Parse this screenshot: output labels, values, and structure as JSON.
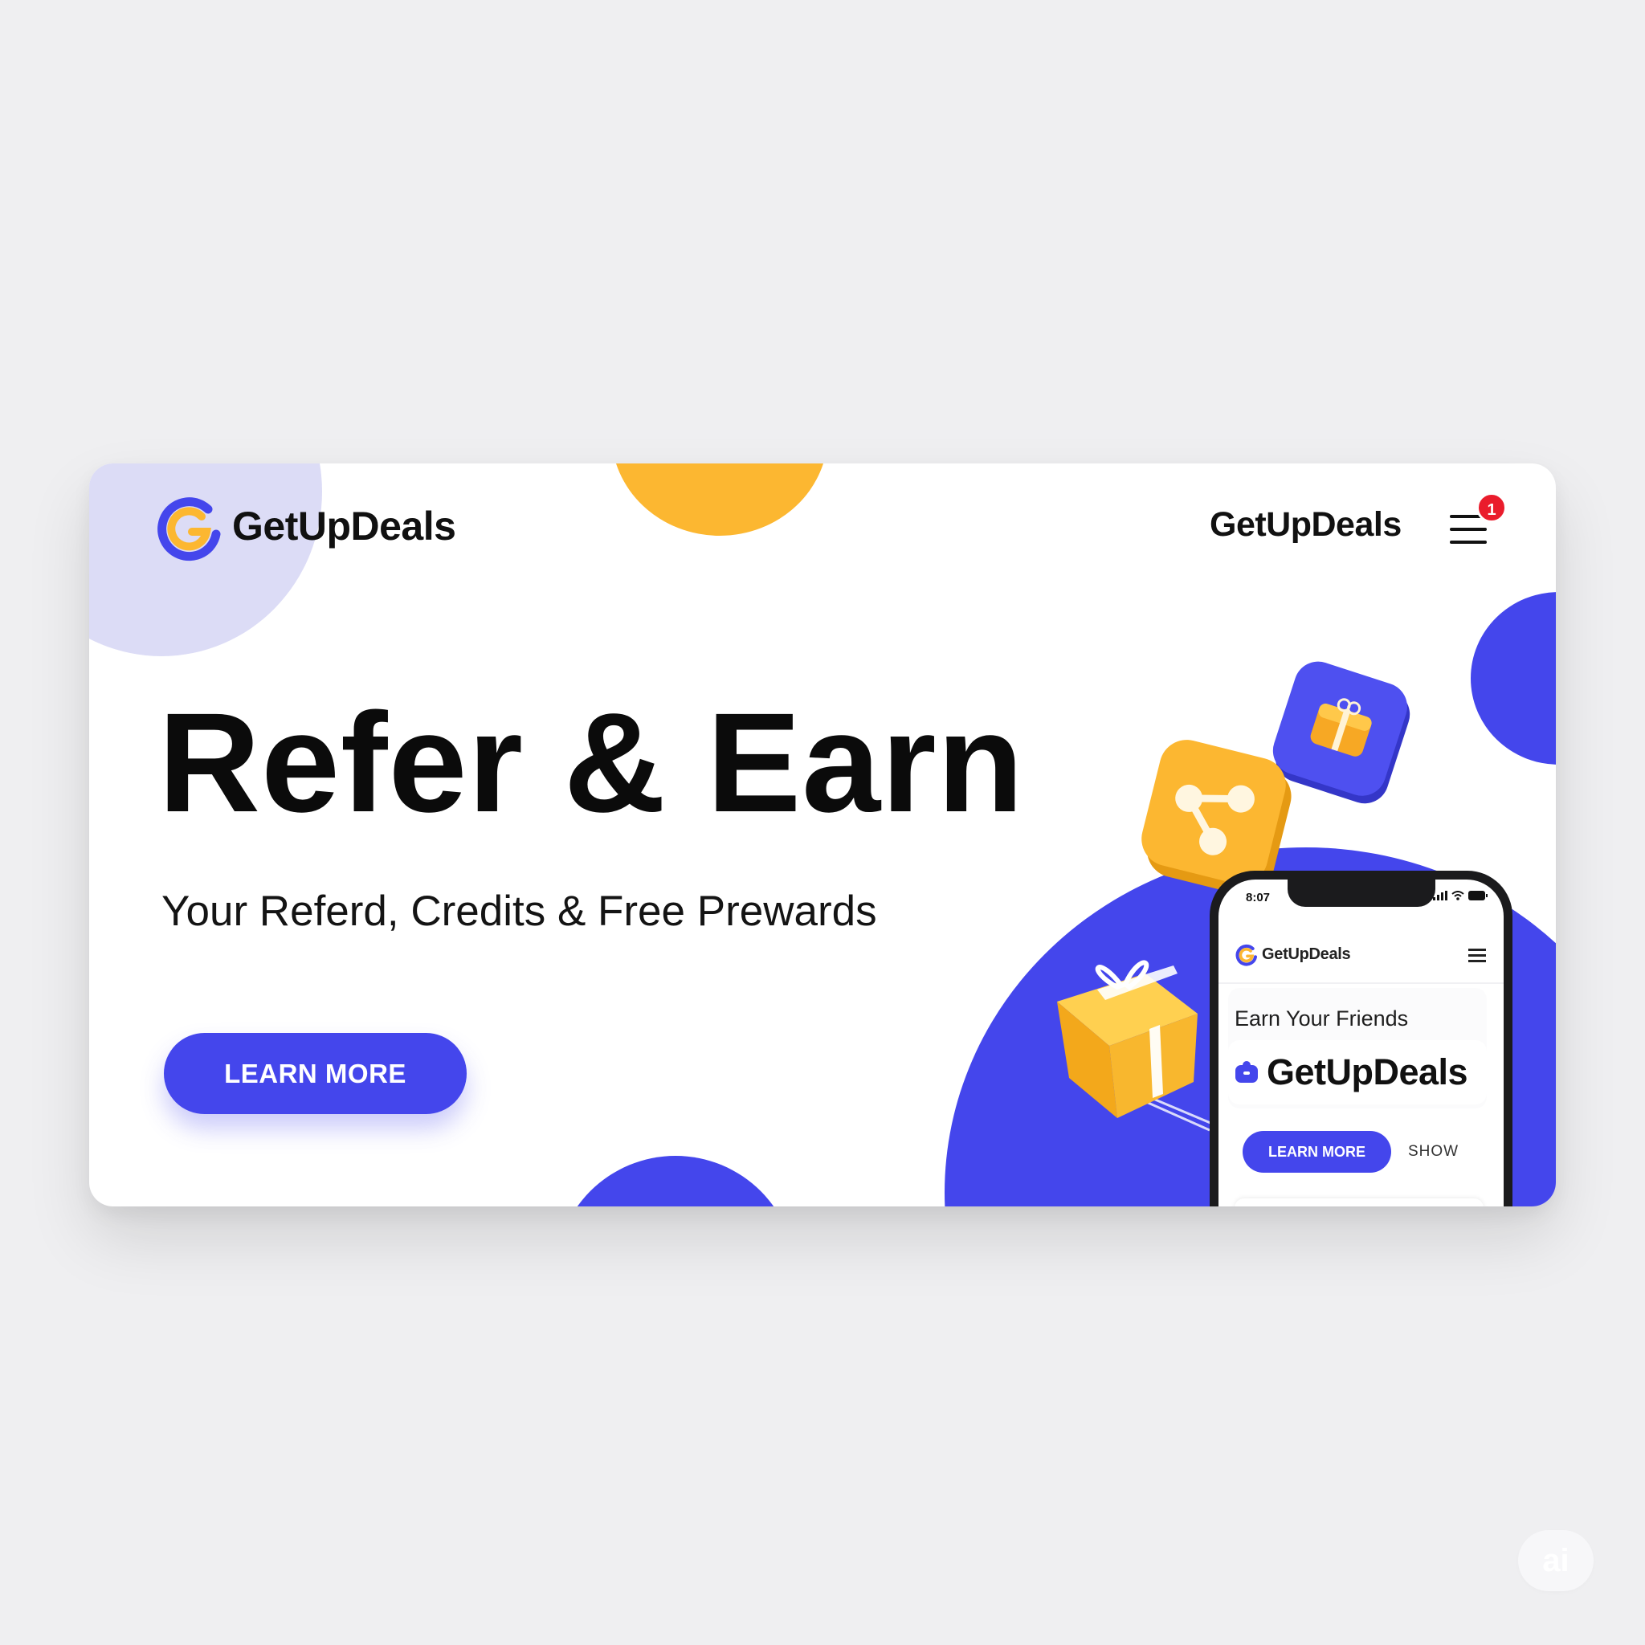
{
  "brand": {
    "name": "GetUpDeals",
    "primary_color": "#4446ec",
    "accent_color": "#fcb731",
    "logo_icon": "g-logo-icon"
  },
  "nav": {
    "title": "GetUpDeals",
    "menu_icon": "hamburger-menu-icon",
    "notification_count": "1"
  },
  "hero": {
    "title": "Refer & Earn",
    "subtitle": "Your Referd, Credits & Free Prewards",
    "cta_label": "LEARN MORE"
  },
  "illustrations": {
    "share_tile_icon": "share-icon",
    "gift_tile_icon": "gift-icon",
    "gift_box_icon": "gift-box-icon"
  },
  "phone": {
    "status_time": "8:07",
    "app_name": "GetUpDeals",
    "heading": "Earn Your Friends",
    "brand_large": "GetUpDeals",
    "cta_label": "LEARN MORE",
    "secondary_label": "SHOW"
  },
  "watermark": {
    "label": "ai"
  }
}
